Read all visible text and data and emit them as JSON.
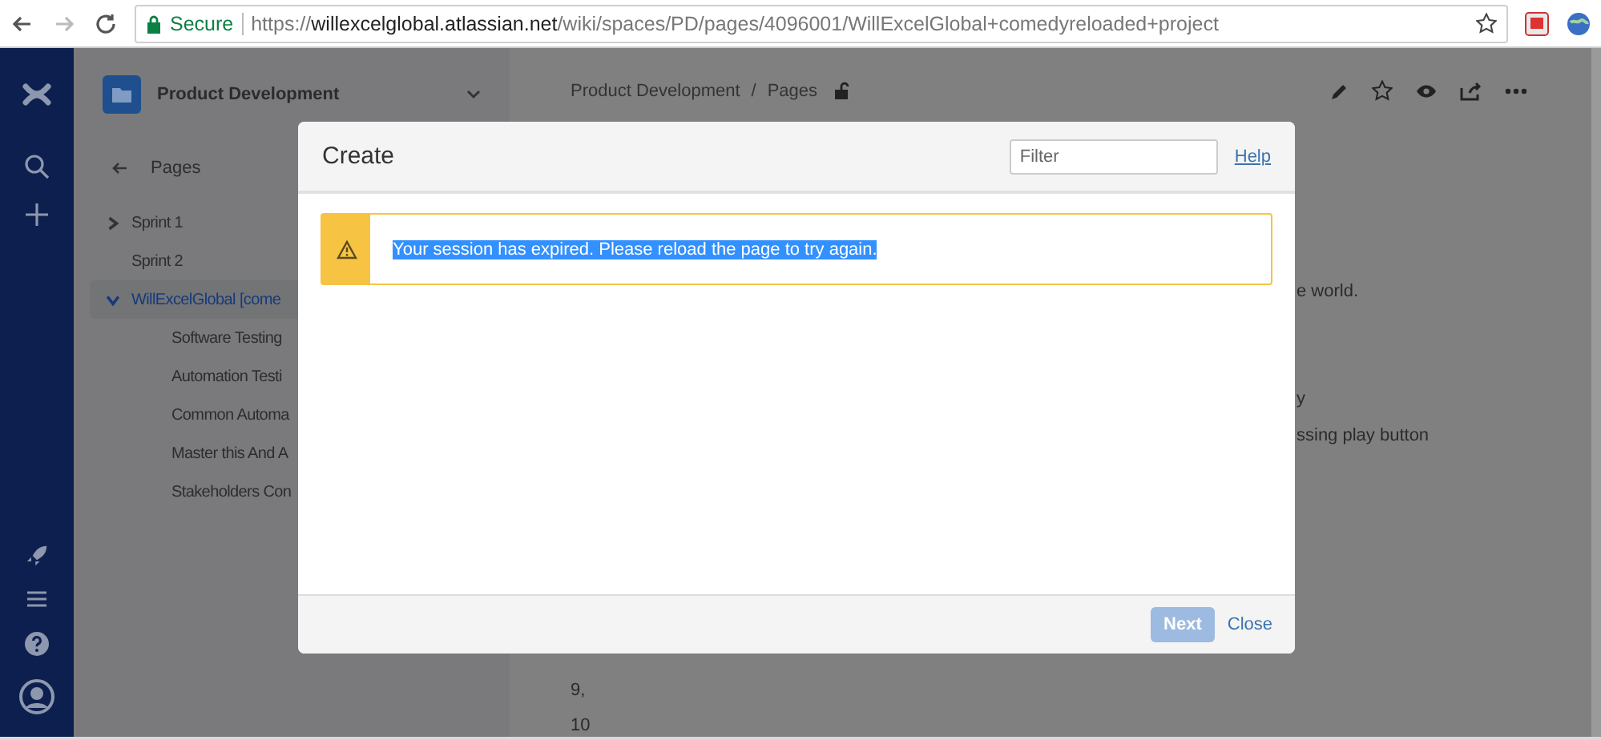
{
  "browser": {
    "secure_label": "Secure",
    "url": "https://**willexcelglobal.atlassian.net**/wiki/spaces/PD/pages/4096001/WillExcelGlobal+comedyreloaded+project"
  },
  "space": {
    "name": "Product Development"
  },
  "sidebar": {
    "back_label": "Pages",
    "items": [
      {
        "label": "Sprint 1",
        "expanded": false,
        "selected": false,
        "has_children": true
      },
      {
        "label": "Sprint 2",
        "selected": false,
        "has_children": false
      },
      {
        "label": "WillExcelGlobal [come",
        "expanded": true,
        "selected": true,
        "has_children": true,
        "children": [
          {
            "label": "Software Testing",
            "selected": false
          },
          {
            "label": "Automation Testi",
            "selected": false
          },
          {
            "label": "Common Automa",
            "selected": false
          },
          {
            "label": "Master this And A",
            "selected": false
          },
          {
            "label": "Stakeholders Con",
            "selected": false
          }
        ]
      }
    ]
  },
  "breadcrumb": [
    "Product Development",
    "Pages"
  ],
  "breadcrumb_separator": "/",
  "content": {
    "fragments": [
      "e world.",
      "y",
      "ssing play button"
    ],
    "list_items": [
      "9,",
      "10"
    ]
  },
  "dialog": {
    "title": "Create",
    "filter": {
      "placeholder": "Filter"
    },
    "help": "Help",
    "alert": {
      "message": "Your session has expired. Please reload the page to try again.",
      "selected": true
    },
    "buttons": [
      {
        "kind": "primary",
        "label": "Next",
        "disabled": true
      },
      {
        "kind": "link",
        "label": "Close",
        "disabled": false
      }
    ]
  }
}
